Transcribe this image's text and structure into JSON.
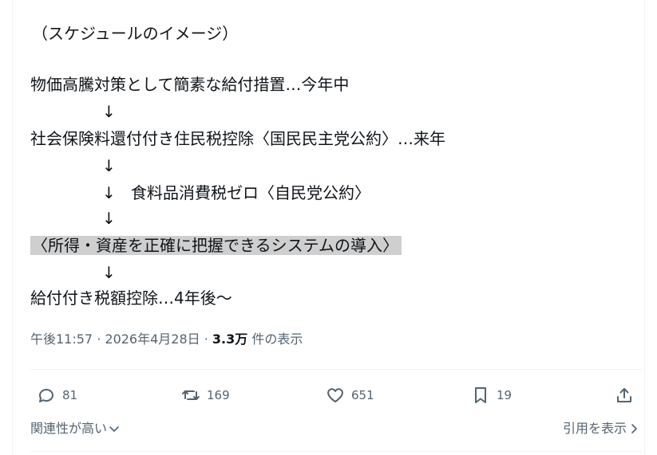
{
  "post": {
    "lines": [
      "（スケジュールのイメージ）",
      "物価高騰対策として簡素な給付措置…今年中",
      "社会保険料還付付き住民税控除〈国民民主党公約〉…来年",
      "食料品消費税ゼロ〈自民党公約〉",
      "〈所得・資産を正確に把握できるシステムの導入〉",
      "給付付き税額控除…4年後〜"
    ],
    "arrow": "↓"
  },
  "meta": {
    "time": "午後11:57",
    "separator": " · ",
    "date": "2026年4月28日",
    "views_count": "3.3万",
    "views_label": " 件の表示"
  },
  "actions": {
    "replies": "81",
    "reposts": "169",
    "likes": "651",
    "bookmarks": "19"
  },
  "footer": {
    "sort_label": "関連性が高い",
    "quotes_label": "引用を表示"
  },
  "colors": {
    "text": "#0f1419",
    "secondary": "#536471",
    "highlight": "#cfcfcf",
    "divider": "#eff3f4"
  }
}
